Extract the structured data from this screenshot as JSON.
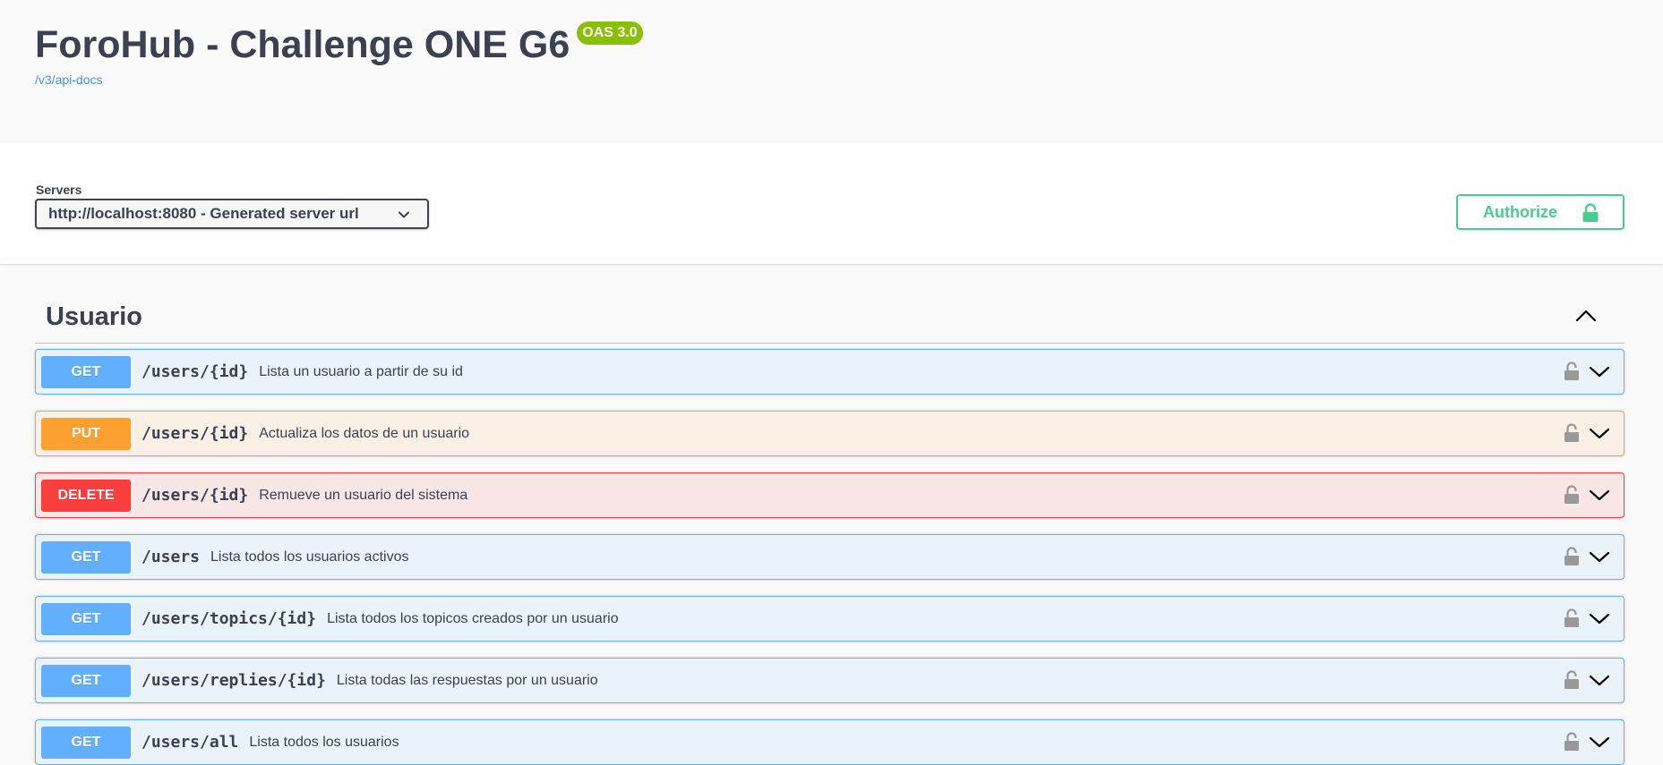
{
  "info": {
    "title": "ForoHub - Challenge ONE G6",
    "version_badge": "OAS 3.0",
    "api_docs_link": "/v3/api-docs"
  },
  "servers": {
    "label": "Servers",
    "selected": "http://localhost:8080 - Generated server url",
    "chevron_icon": "chevron-down-icon"
  },
  "authorize": {
    "label": "Authorize",
    "icon": "unlocked-lock-icon",
    "color": "#49cc90"
  },
  "tag": {
    "name": "Usuario",
    "toggle_icon": "chevron-up-icon",
    "operations": [
      {
        "method": "GET",
        "path": "/users/{id}",
        "summary": "Lista un usuario a partir de su id"
      },
      {
        "method": "PUT",
        "path": "/users/{id}",
        "summary": "Actualiza los datos de un usuario"
      },
      {
        "method": "DELETE",
        "path": "/users/{id}",
        "summary": "Remueve un usuario del sistema"
      },
      {
        "method": "GET",
        "path": "/users",
        "summary": "Lista todos los usuarios activos"
      },
      {
        "method": "GET",
        "path": "/users/topics/{id}",
        "summary": "Lista todos los topicos creados por un usuario"
      },
      {
        "method": "GET",
        "path": "/users/replies/{id}",
        "summary": "Lista todas las respuestas por un usuario"
      },
      {
        "method": "GET",
        "path": "/users/all",
        "summary": "Lista todos los usuarios"
      }
    ]
  },
  "colors": {
    "get": "#61affe",
    "put": "#fca130",
    "delete": "#f93e3e",
    "oas_badge": "#89bf04",
    "link": "#4990e2"
  }
}
